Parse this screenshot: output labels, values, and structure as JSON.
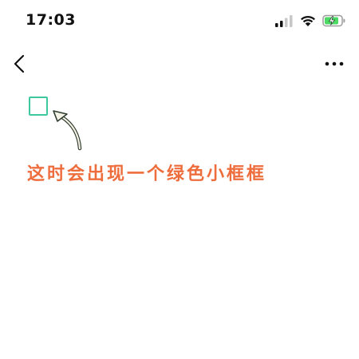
{
  "status_bar": {
    "time": "17:03",
    "signal_icon": "cellular-signal-icon",
    "wifi_icon": "wifi-icon",
    "battery_icon": "battery-charging-icon",
    "battery_color": "#4cd964"
  },
  "nav_bar": {
    "back_icon": "chevron-left-icon",
    "more_icon": "more-horizontal-icon"
  },
  "content": {
    "annotation_text": "这时会出现一个绿色小框框",
    "annotation_color": "#ee6d3d",
    "box_border_color": "#3ec8a0",
    "arrow_icon": "curved-arrow-icon"
  }
}
